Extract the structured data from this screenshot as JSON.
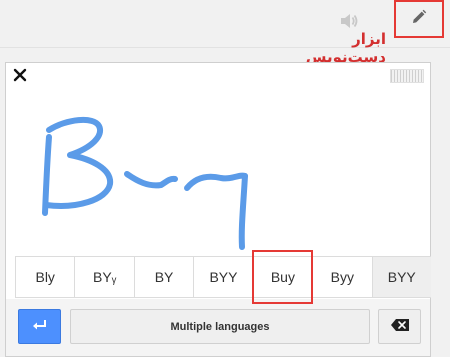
{
  "header": {
    "caption": "ابزار دست‌نویس",
    "speaker_icon": "speaker-icon",
    "pencil_icon": "pencil-icon",
    "highlight_color": "#e53935"
  },
  "panel": {
    "close_icon": "close-icon",
    "drag_handle": "drag-handle",
    "ink_color": "#5b9be8",
    "handwriting_hint": "Buy"
  },
  "candidates": [
    "Bly",
    "BYᵧ",
    "BY",
    "BYY",
    "Buy",
    "Byy",
    "BYY"
  ],
  "selected_candidate": "Buy",
  "footer": {
    "enter_icon": "enter-icon",
    "language_button": "Multiple languages",
    "backspace_icon": "backspace-icon",
    "enter_color": "#4d90fe"
  }
}
